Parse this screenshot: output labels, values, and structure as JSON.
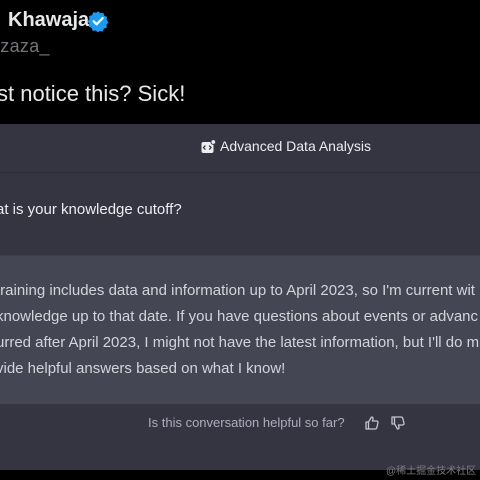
{
  "tweet": {
    "author_name": "Khawaja",
    "handle": "lzaza_",
    "text": "st notice this? Sick!",
    "verified_icon": "verified-badge-icon",
    "verified_color": "#1d9bf0"
  },
  "chat": {
    "model_label": "Advanced Data Analysis",
    "model_icon": "code-interpreter-icon",
    "user_message": "at is your knowledge cutoff?",
    "assistant_lines": [
      "training includes data and information up to April 2023, so I'm current wit",
      "knowledge up to that date. If you have questions about events or advanc",
      "urred after April 2023, I might not have the latest information, but I'll do m",
      "vide helpful answers based on what I know!"
    ],
    "feedback_question": "Is this conversation helpful so far?",
    "feedback_icons": [
      "thumbs-up-icon",
      "thumbs-down-icon"
    ]
  },
  "watermark": "@稀土掘金技术社区",
  "colors": {
    "page_bg": "#000000",
    "chat_bg": "#343541",
    "assistant_bg": "#444654",
    "text": "#ececf1"
  }
}
